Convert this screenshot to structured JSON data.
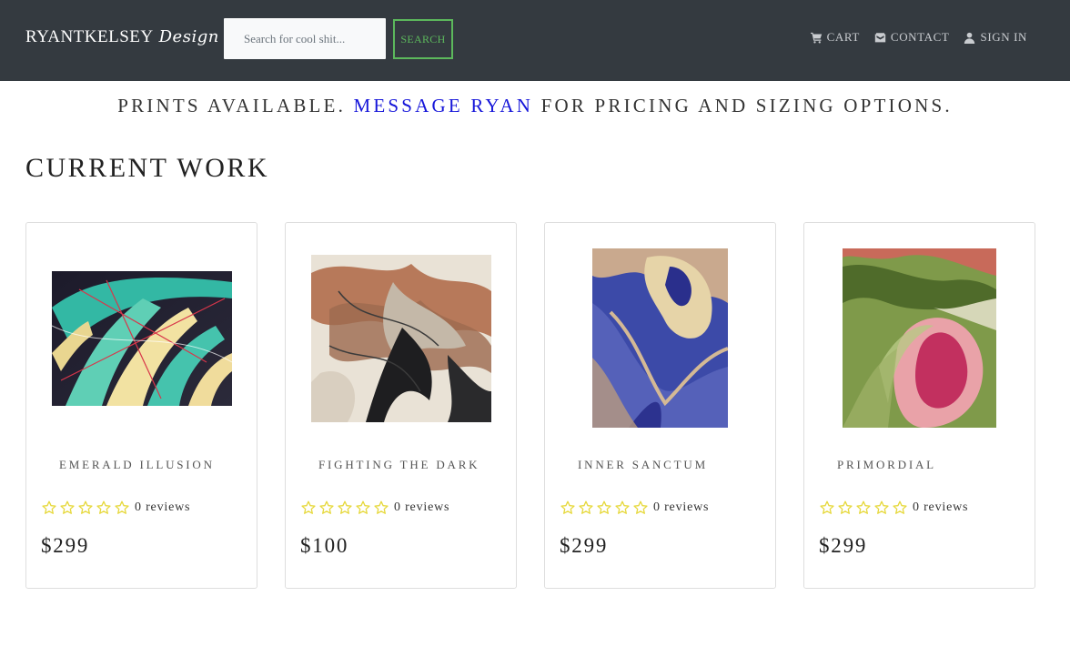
{
  "brand": {
    "main": "RYANTKELSEY",
    "script": "Design"
  },
  "search": {
    "placeholder": "Search for cool shit...",
    "value": "",
    "button_label": "SEARCH"
  },
  "nav": {
    "cart": {
      "label": "CART",
      "icon": "cart-icon"
    },
    "contact": {
      "label": "CONTACT",
      "icon": "envelope-icon"
    },
    "signin": {
      "label": "SIGN IN",
      "icon": "user-icon"
    }
  },
  "banner": {
    "before": "PRINTS AVAILABLE. ",
    "link": "MESSAGE RYAN",
    "after": " FOR PRICING AND SIZING OPTIONS."
  },
  "section_title": "CURRENT WORK",
  "products": [
    {
      "title": "EMERALD ILLUSION",
      "reviews": "0 reviews",
      "price": "$299",
      "stars_filled": 0,
      "stars_total": 5
    },
    {
      "title": "FIGHTING THE DARK",
      "reviews": "0 reviews",
      "price": "$100",
      "stars_filled": 0,
      "stars_total": 5
    },
    {
      "title": "INNER SANCTUM",
      "reviews": "0 reviews",
      "price": "$299",
      "stars_filled": 0,
      "stars_total": 5
    },
    {
      "title": "PRIMORDIAL",
      "reviews": "0 reviews",
      "price": "$299",
      "stars_filled": 0,
      "stars_total": 5
    }
  ],
  "colors": {
    "navbar": "#343a40",
    "search_button": "#5cb85c",
    "banner_link": "#1515d9",
    "star_outline": "#e6d83a"
  }
}
